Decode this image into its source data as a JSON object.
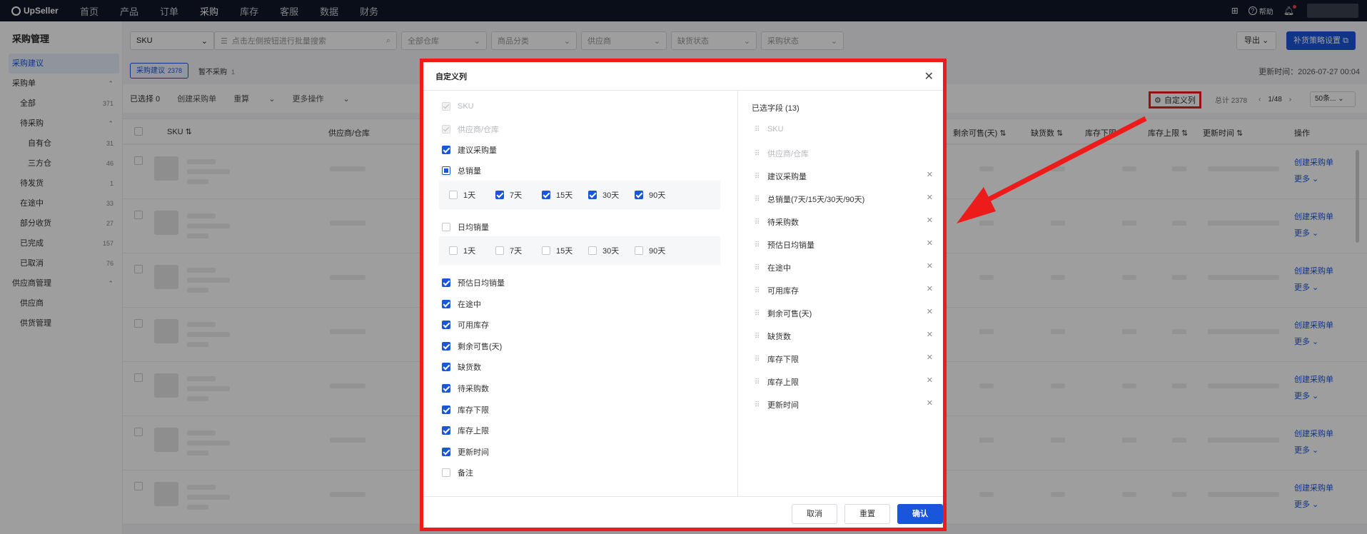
{
  "topbar": {
    "brand": "UpSeller",
    "nav": [
      "首页",
      "产品",
      "订单",
      "采购",
      "库存",
      "客服",
      "数据",
      "财务"
    ],
    "help": "帮助"
  },
  "sidebar": {
    "title": "采购管理",
    "items": [
      {
        "label": "采购建议",
        "count": "",
        "level": 1,
        "active": true
      },
      {
        "label": "采购单",
        "count": "",
        "level": 1,
        "chev": "^"
      },
      {
        "label": "全部",
        "count": "371",
        "level": 2
      },
      {
        "label": "待采购",
        "count": "",
        "level": 2,
        "chev": "^"
      },
      {
        "label": "自有仓",
        "count": "31",
        "level": 3
      },
      {
        "label": "三方仓",
        "count": "46",
        "level": 3
      },
      {
        "label": "待发货",
        "count": "1",
        "level": 2
      },
      {
        "label": "在途中",
        "count": "33",
        "level": 2
      },
      {
        "label": "部分收货",
        "count": "27",
        "level": 2
      },
      {
        "label": "已完成",
        "count": "157",
        "level": 2
      },
      {
        "label": "已取消",
        "count": "76",
        "level": 2
      },
      {
        "label": "供应商管理",
        "count": "",
        "level": 1,
        "chev": "^"
      },
      {
        "label": "供应商",
        "count": "",
        "level": 2
      },
      {
        "label": "供货管理",
        "count": "",
        "level": 2
      }
    ]
  },
  "filters": {
    "sku": "SKU",
    "search_placeholder": "点击左侧按钮进行批量搜索",
    "warehouse": "全部仓库",
    "category": "商品分类",
    "supplier": "供应商",
    "shortage": "缺货状态",
    "purchase": "采购状态",
    "export": "导出",
    "strategy": "补货策略设置"
  },
  "tabs": {
    "active_label": "采购建议",
    "active_count": "2378",
    "other_label": "暂不采购",
    "other_count": "1",
    "updated": "更新时间：2026-07-27 00:04"
  },
  "ops": {
    "selected": "已选择 0",
    "create": "创建采购单",
    "recalc": "重算",
    "more": "更多操作",
    "custom_columns": "自定义列",
    "total": "总计 2378",
    "page": "1/48",
    "page_size": "50条..."
  },
  "table": {
    "headers": {
      "sku": "SKU",
      "supplier": "供应商/仓库",
      "remain": "剩余可售(天)",
      "shortage": "缺货数",
      "min": "库存下限",
      "max": "库存上限",
      "updated": "更新时间",
      "action": "操作"
    },
    "row_action_1": "创建采购单",
    "row_action_2": "更多"
  },
  "modal": {
    "title": "自定义列",
    "left_options": [
      {
        "label": "SKU",
        "state": "disabled"
      },
      {
        "label": "供应商/仓库",
        "state": "disabled"
      },
      {
        "label": "建议采购量",
        "state": "on"
      },
      {
        "label": "总销量",
        "state": "indeterminate"
      }
    ],
    "total_sales_sub": [
      {
        "label": "1天",
        "state": "off"
      },
      {
        "label": "7天",
        "state": "on"
      },
      {
        "label": "15天",
        "state": "on"
      },
      {
        "label": "30天",
        "state": "on"
      },
      {
        "label": "90天",
        "state": "on"
      }
    ],
    "daily_sales": {
      "label": "日均销量",
      "state": "off"
    },
    "daily_sales_sub": [
      {
        "label": "1天",
        "state": "off"
      },
      {
        "label": "7天",
        "state": "off"
      },
      {
        "label": "15天",
        "state": "off"
      },
      {
        "label": "30天",
        "state": "off"
      },
      {
        "label": "90天",
        "state": "off"
      }
    ],
    "more_options": [
      {
        "label": "预估日均销量",
        "state": "on"
      },
      {
        "label": "在途中",
        "state": "on"
      },
      {
        "label": "可用库存",
        "state": "on"
      },
      {
        "label": "剩余可售(天)",
        "state": "on"
      },
      {
        "label": "缺货数",
        "state": "on"
      },
      {
        "label": "待采购数",
        "state": "on"
      },
      {
        "label": "库存下限",
        "state": "on"
      },
      {
        "label": "库存上限",
        "state": "on"
      },
      {
        "label": "更新时间",
        "state": "on"
      },
      {
        "label": "备注",
        "state": "off"
      }
    ],
    "selected_title": "已选字段 (13)",
    "selected_fields": [
      {
        "label": "SKU",
        "fixed": true
      },
      {
        "label": "供应商/仓库",
        "fixed": true
      },
      {
        "label": "建议采购量",
        "fixed": false
      },
      {
        "label": "总销量(7天/15天/30天/90天)",
        "fixed": false
      },
      {
        "label": "待采购数",
        "fixed": false
      },
      {
        "label": "预估日均销量",
        "fixed": false
      },
      {
        "label": "在途中",
        "fixed": false
      },
      {
        "label": "可用库存",
        "fixed": false
      },
      {
        "label": "剩余可售(天)",
        "fixed": false
      },
      {
        "label": "缺货数",
        "fixed": false
      },
      {
        "label": "库存下限",
        "fixed": false
      },
      {
        "label": "库存上限",
        "fixed": false
      },
      {
        "label": "更新时间",
        "fixed": false
      }
    ],
    "cancel": "取消",
    "reset": "重置",
    "confirm": "确认"
  },
  "colors": {
    "accent": "#1a56db",
    "highlight": "#ee1b1b",
    "topbar": "#101828"
  }
}
